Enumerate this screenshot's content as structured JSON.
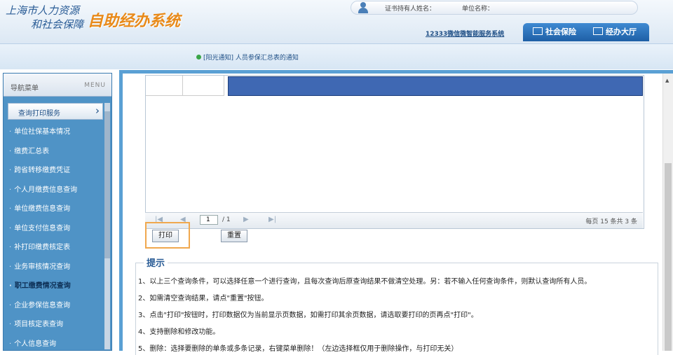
{
  "header": {
    "logo_line1": "上海市人力资源",
    "logo_line2": "和社会保障",
    "system_title": "自助经办系统",
    "cert_holder_label": "证书持有人姓名：",
    "org_name_label": "单位名称：",
    "service_link": "12333微信微智能服务系统",
    "tabs": [
      {
        "label": "社会保险"
      },
      {
        "label": "经办大厅"
      }
    ]
  },
  "notice": {
    "text": "[阳光通知] 人员参保汇总表的通知"
  },
  "sidebar": {
    "title": "导航菜单",
    "title_en": "MENU",
    "section": "查询打印服务",
    "items": [
      {
        "label": "单位社保基本情况"
      },
      {
        "label": "缴费汇总表"
      },
      {
        "label": "跨省转移缴费凭证"
      },
      {
        "label": "个人月缴费信息查询"
      },
      {
        "label": "单位缴费信息查询"
      },
      {
        "label": "单位支付信息查询"
      },
      {
        "label": "补打印缴费核定表"
      },
      {
        "label": "业务审核情况查询"
      },
      {
        "label": "职工缴费情况查询"
      },
      {
        "label": "企业参保信息查询"
      },
      {
        "label": "项目核定表查询"
      },
      {
        "label": "个人信息查询"
      }
    ],
    "active_index": 8
  },
  "pager": {
    "page_value": "1",
    "page_total": "/ 1",
    "summary": "每页 15 条共 3 条"
  },
  "buttons": {
    "print": "打印",
    "reset": "重置"
  },
  "tips": {
    "title": "提示",
    "items": [
      "1、以上三个查询条件，可以选择任意一个进行查询，且每次查询后原查询结果不做清空处理。另：若不输入任何查询条件，则默认查询所有人员。",
      "2、如需清空查询结果，请点\"重置\"按钮。",
      "3、点击\"打印\"按钮时，打印数据仅为当前显示页数据，如需打印其余页数据，请选取要打印的页再点\"打印\"。",
      "4、支持删除和修改功能。",
      "5、删除：选择要删除的单条或多条记录，右键菜单删除！（左边选择框仅用于删除操作，与打印无关）"
    ]
  },
  "colors": {
    "brand_blue": "#2a5c96",
    "title_orange": "#e88a1a",
    "sidebar_blue": "#4f93c6",
    "highlight_orange": "#f0a84e",
    "redaction_blue": "#3f68b3"
  },
  "icons": [
    "user-icon",
    "social-insurance-icon",
    "service-hall-icon",
    "chevron-right-icon",
    "page-first-icon",
    "page-prev-icon",
    "page-next-icon",
    "page-last-icon",
    "scroll-up-arrow-icon"
  ]
}
